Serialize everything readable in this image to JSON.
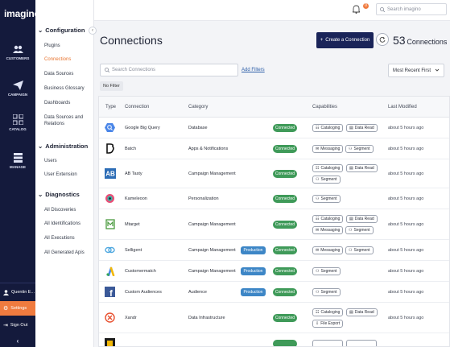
{
  "brand": {
    "logo_text": "imagino"
  },
  "rail": {
    "items": [
      {
        "label": "CUSTOMERS",
        "icon": "users-icon"
      },
      {
        "label": "CAMPAIGN",
        "icon": "paper-plane-icon"
      },
      {
        "label": "CATALOG",
        "icon": "grid-icon"
      },
      {
        "label": "MANAGE",
        "icon": "layers-icon"
      }
    ],
    "user": "Quentin E...",
    "settings": "Settings",
    "signout": "Sign Out"
  },
  "sidebar": {
    "groups": [
      {
        "title": "Configuration",
        "links": [
          "Plugins",
          "Connections",
          "Data Sources",
          "Business Glossary",
          "Dashboards",
          "Data Sources and Relations"
        ]
      },
      {
        "title": "Administration",
        "links": [
          "Users",
          "User Extension"
        ]
      },
      {
        "title": "Diagnostics",
        "links": [
          "All Discoveries",
          "All Identifications",
          "All Executions",
          "All Generated Apis"
        ]
      }
    ],
    "active_link": "Connections"
  },
  "topbar": {
    "search_placeholder": "Search imagino",
    "notification_count": "0"
  },
  "header": {
    "title": "Connections",
    "create_label": "Create a Connection",
    "count": "53",
    "count_label": "Connections"
  },
  "filters": {
    "search_placeholder": "Search Connections",
    "add_filters": "Add Filters",
    "sort_selected": "Most Recent First",
    "no_filter": "No Filter"
  },
  "table": {
    "columns": [
      "Type",
      "Connection",
      "Category",
      "Capabilities",
      "Last Modified"
    ],
    "rows": [
      {
        "name": "Google Big Query",
        "category": "Database",
        "status": "Connected",
        "production": "",
        "caps": [
          "Cataloging",
          "Data Read"
        ],
        "modified": "about 5 hours ago",
        "logo": "bigquery-logo-icon"
      },
      {
        "name": "Batch",
        "category": "Apps & Notifications",
        "status": "Connected",
        "production": "",
        "caps": [
          "Messaging",
          "Segment"
        ],
        "modified": "about 5 hours ago",
        "logo": "batch-logo-icon"
      },
      {
        "name": "AB Tasty",
        "category": "Campaign Management",
        "status": "Connected",
        "production": "",
        "caps": [
          "Cataloging",
          "Data Read",
          "Segment"
        ],
        "modified": "about 5 hours ago",
        "logo": "abtasty-logo-icon"
      },
      {
        "name": "Kameleoon",
        "category": "Personalization",
        "status": "Connected",
        "production": "",
        "caps": [
          "Segment"
        ],
        "modified": "about 5 hours ago",
        "logo": "kameleoon-logo-icon"
      },
      {
        "name": "Mtarget",
        "category": "Campaign Management",
        "status": "Connected",
        "production": "",
        "caps": [
          "Cataloging",
          "Data Read",
          "Messaging",
          "Segment"
        ],
        "modified": "about 5 hours ago",
        "logo": "mtarget-logo-icon"
      },
      {
        "name": "Selligent",
        "category": "Campaign Management",
        "status": "Connected",
        "production": "Production",
        "caps": [
          "Messaging",
          "Segment"
        ],
        "modified": "about 5 hours ago",
        "logo": "selligent-logo-icon"
      },
      {
        "name": "Customermatch",
        "category": "Campaign Management",
        "status": "Connected",
        "production": "Production",
        "caps": [
          "Segment"
        ],
        "modified": "about 5 hours ago",
        "logo": "google-ads-logo-icon"
      },
      {
        "name": "Custom Audiences",
        "category": "Audience",
        "status": "Connected",
        "production": "Production",
        "caps": [
          "Segment"
        ],
        "modified": "about 5 hours ago",
        "logo": "facebook-logo-icon"
      },
      {
        "name": "Xandr",
        "category": "Data Infrastructure",
        "status": "Connected",
        "production": "",
        "caps": [
          "Cataloging",
          "Data Read",
          "File Export"
        ],
        "modified": "about 5 hours ago",
        "logo": "xandr-logo-icon"
      }
    ]
  },
  "colors": {
    "rail_bg": "#141a3c",
    "accent": "#f07b3f",
    "primary": "#1a2459",
    "connected": "#3f9a59",
    "production": "#3d86c6"
  }
}
